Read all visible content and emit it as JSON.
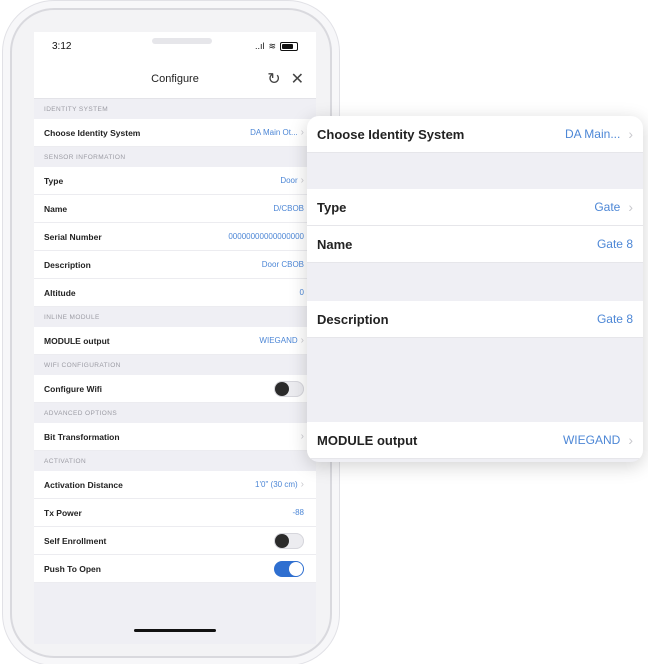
{
  "status": {
    "time": "3:12",
    "signal": "..ıl",
    "wifi": "≋"
  },
  "nav": {
    "title": "Configure"
  },
  "sections": [
    {
      "header": "IDENTITY SYSTEM",
      "rows": [
        {
          "label": "Choose Identity System",
          "value": "DA Main Ot...",
          "chevron": true
        }
      ]
    },
    {
      "header": "SENSOR INFORMATION",
      "rows": [
        {
          "label": "Type",
          "value": "Door",
          "chevron": true
        },
        {
          "label": "Name",
          "value": "D/CBOB",
          "chevron": false
        },
        {
          "label": "Serial Number",
          "value": "00000000000000000",
          "chevron": false
        },
        {
          "label": "Description",
          "value": "Door CBOB",
          "chevron": false
        },
        {
          "label": "Altitude",
          "value": "0",
          "chevron": false
        }
      ]
    },
    {
      "header": "INLINE MODULE",
      "rows": [
        {
          "label": "MODULE output",
          "value": "WIEGAND",
          "chevron": true
        }
      ]
    },
    {
      "header": "WIFI CONFIGURATION",
      "rows": [
        {
          "label": "Configure Wifi",
          "toggle": "off"
        }
      ]
    },
    {
      "header": "ADVANCED OPTIONS",
      "rows": [
        {
          "label": "Bit Transformation",
          "value": "",
          "chevron": true
        }
      ]
    },
    {
      "header": "ACTIVATION",
      "rows": [
        {
          "label": "Activation Distance",
          "value": "1'0\" (30 cm)",
          "chevron": true
        },
        {
          "label": "Tx Power",
          "value": "-88",
          "chevron": false
        },
        {
          "label": "Self Enrollment",
          "toggle": "off"
        },
        {
          "label": "Push To Open",
          "toggle": "on"
        }
      ]
    }
  ],
  "zoom": {
    "choose_identity": {
      "label": "Choose Identity System",
      "value": "DA Main..."
    },
    "type": {
      "label": "Type",
      "value": "Gate"
    },
    "name": {
      "label": "Name",
      "value": "Gate 8"
    },
    "description": {
      "label": "Description",
      "value": "Gate 8"
    },
    "module_output": {
      "label": "MODULE output",
      "value": "WIEGAND"
    }
  },
  "colors": {
    "accent": "#4d87d6",
    "toggle_on": "#2f6fd0"
  }
}
